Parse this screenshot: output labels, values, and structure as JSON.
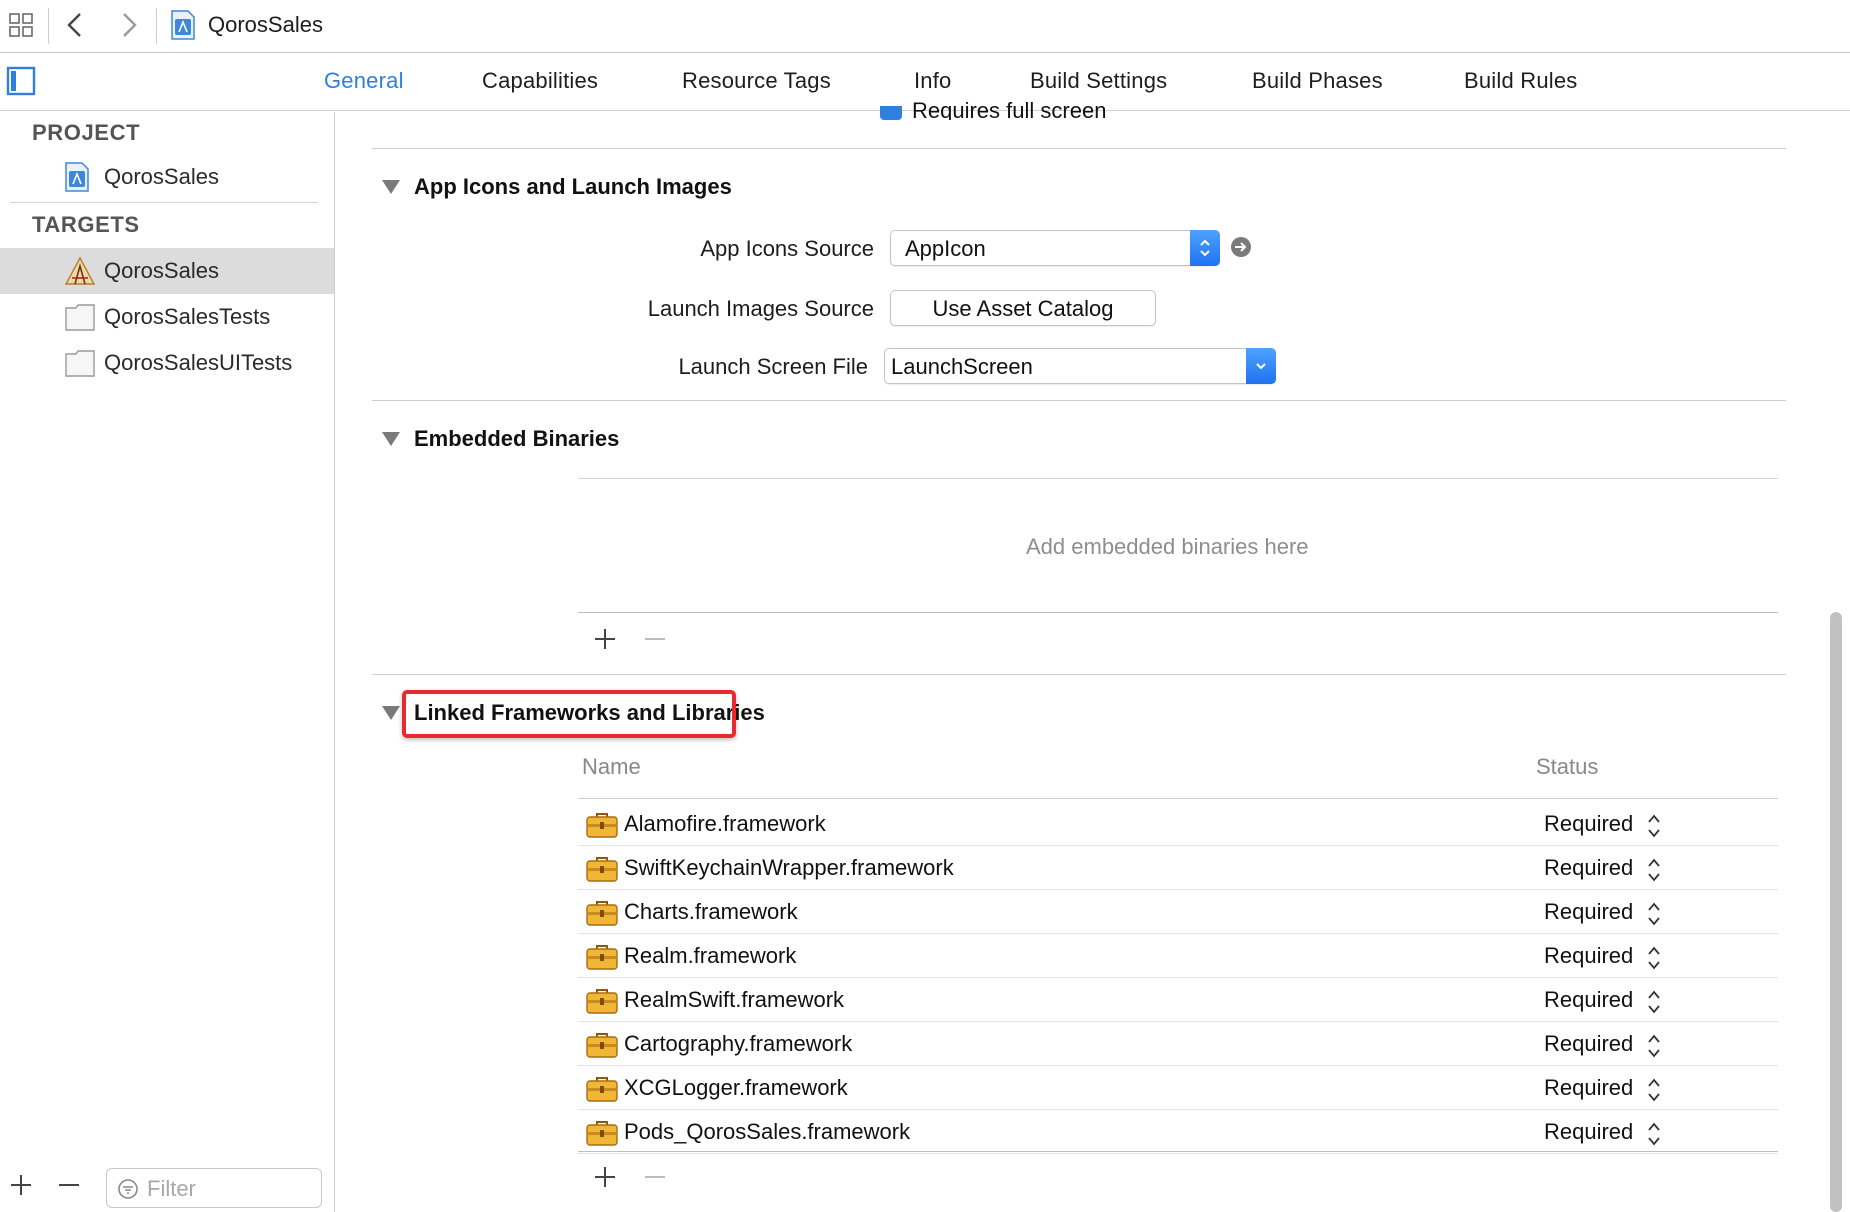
{
  "jumpbar": {
    "project_name": "QorosSales",
    "icons": [
      "grid-icon",
      "back-arrow-icon",
      "forward-arrow-icon",
      "project-file-icon"
    ]
  },
  "tabs": [
    {
      "label": "General",
      "active": true
    },
    {
      "label": "Capabilities"
    },
    {
      "label": "Resource Tags"
    },
    {
      "label": "Info"
    },
    {
      "label": "Build Settings"
    },
    {
      "label": "Build Phases"
    },
    {
      "label": "Build Rules"
    }
  ],
  "sidebar": {
    "project_heading": "PROJECT",
    "project_item": "QorosSales",
    "targets_heading": "TARGETS",
    "targets": [
      {
        "label": "QorosSales",
        "selected": true,
        "icon": "app-target-icon"
      },
      {
        "label": "QorosSalesTests",
        "icon": "test-target-icon"
      },
      {
        "label": "QorosSalesUITests",
        "icon": "test-target-icon"
      }
    ],
    "filter_placeholder": "Filter"
  },
  "sections": {
    "partial_checkbox_label": "Requires full screen",
    "app_icons": {
      "title": "App Icons and Launch Images",
      "app_icons_source_label": "App Icons Source",
      "app_icons_source_value": "AppIcon",
      "launch_images_source_label": "Launch Images Source",
      "launch_images_button": "Use Asset Catalog",
      "launch_screen_file_label": "Launch Screen File",
      "launch_screen_file_value": "LaunchScreen"
    },
    "embedded": {
      "title": "Embedded Binaries",
      "placeholder": "Add embedded binaries here"
    },
    "linked": {
      "title": "Linked Frameworks and Libraries",
      "col_name": "Name",
      "col_status": "Status",
      "frameworks": [
        {
          "name": "Alamofire.framework",
          "status": "Required"
        },
        {
          "name": "SwiftKeychainWrapper.framework",
          "status": "Required"
        },
        {
          "name": "Charts.framework",
          "status": "Required"
        },
        {
          "name": "Realm.framework",
          "status": "Required"
        },
        {
          "name": "RealmSwift.framework",
          "status": "Required"
        },
        {
          "name": "Cartography.framework",
          "status": "Required"
        },
        {
          "name": "XCGLogger.framework",
          "status": "Required"
        },
        {
          "name": "Pods_QorosSales.framework",
          "status": "Required"
        }
      ]
    }
  },
  "colors": {
    "accent": "#2f7fe0",
    "highlight": "#e8292e",
    "selection": "#dcdcdc"
  }
}
